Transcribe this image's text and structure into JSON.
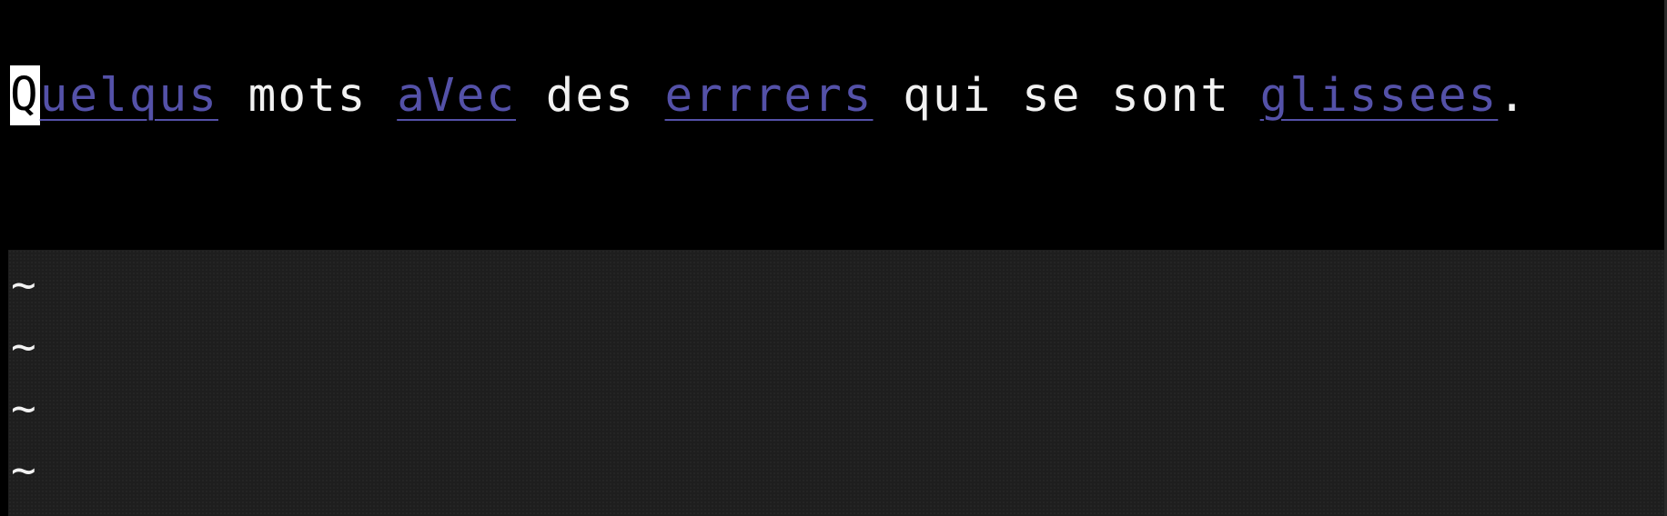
{
  "editor": {
    "cursor_char": "Q",
    "line_segments": [
      {
        "text": "uelqus",
        "misspelled": true
      },
      {
        "text": " mots ",
        "misspelled": false
      },
      {
        "text": "aVec",
        "misspelled": true
      },
      {
        "text": " des ",
        "misspelled": false
      },
      {
        "text": "errrers",
        "misspelled": true
      },
      {
        "text": " qui se sont ",
        "misspelled": false
      },
      {
        "text": "glissees",
        "misspelled": true
      },
      {
        "text": ".",
        "misspelled": false
      }
    ],
    "empty_line_marker": "~",
    "empty_line_markers": [
      "~",
      "~",
      "~",
      "~"
    ]
  },
  "colors": {
    "background": "#000000",
    "text": "#f2f2f2",
    "spell_error": "#5451a8",
    "cursor_bg": "#ffffff",
    "empty_area_bg": "#1e1e1e"
  }
}
